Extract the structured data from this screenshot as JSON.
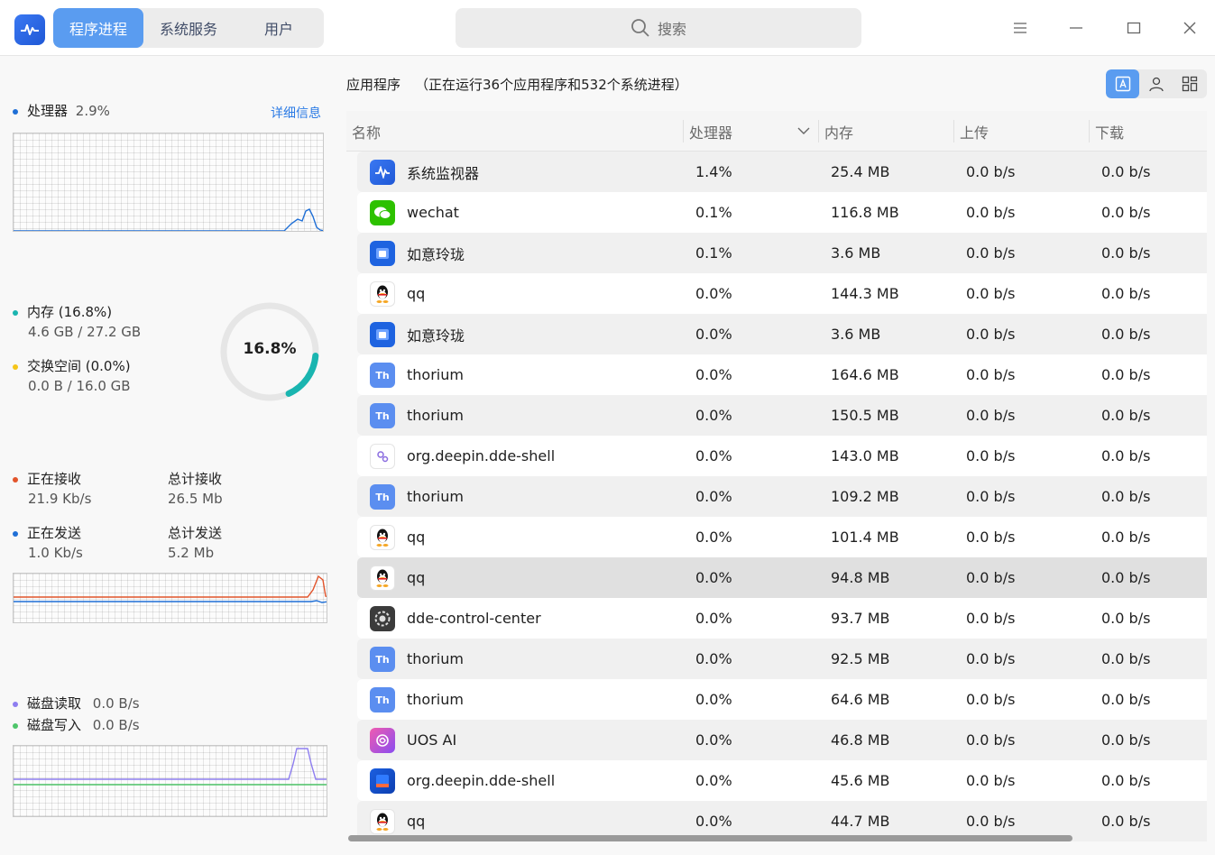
{
  "tabs": [
    "程序进程",
    "系统服务",
    "用户"
  ],
  "search": {
    "placeholder": "搜索"
  },
  "sidebar": {
    "cpu": {
      "label": "处理器",
      "value": "2.9%",
      "details_link": "详细信息",
      "color": "#1f6fd6"
    },
    "memory": {
      "label": "内存 (16.8%)",
      "detail": "4.6 GB / 27.2 GB",
      "percent_text": "16.8%",
      "percent": 16.8,
      "color": "#1ab5b0"
    },
    "swap": {
      "label": "交换空间 (0.0%)",
      "detail": "0.0 B / 16.0 GB",
      "color": "#f5c518"
    },
    "network": {
      "receiving_label": "正在接收",
      "receiving_value": "21.9 Kb/s",
      "total_received_label": "总计接收",
      "total_received_value": "26.5 Mb",
      "sending_label": "正在发送",
      "sending_value": "1.0 Kb/s",
      "total_sent_label": "总计发送",
      "total_sent_value": "5.2 Mb",
      "receive_color": "#e2542b",
      "send_color": "#1f6fd6"
    },
    "disk": {
      "read_label": "磁盘读取",
      "read_value": "0.0 B/s",
      "write_label": "磁盘写入",
      "write_value": "0.0 B/s",
      "read_color": "#8e7ef0",
      "write_color": "#4ec56a"
    }
  },
  "main": {
    "heading": "应用程序",
    "heading_note": "（正在运行36个应用程序和532个系统进程）",
    "columns": [
      "名称",
      "处理器",
      "内存",
      "上传",
      "下载"
    ],
    "rows": [
      {
        "icon": "system-monitor-icon",
        "name": "系统监视器",
        "cpu": "1.4%",
        "mem": "25.4 MB",
        "up": "0.0 b/s",
        "down": "0.0 b/s"
      },
      {
        "icon": "wechat-icon",
        "name": "wechat",
        "cpu": "0.1%",
        "mem": "116.8 MB",
        "up": "0.0 b/s",
        "down": "0.0 b/s"
      },
      {
        "icon": "ruyi-icon",
        "name": "如意玲珑",
        "cpu": "0.1%",
        "mem": "3.6 MB",
        "up": "0.0 b/s",
        "down": "0.0 b/s"
      },
      {
        "icon": "qq-icon",
        "name": "qq",
        "cpu": "0.0%",
        "mem": "144.3 MB",
        "up": "0.0 b/s",
        "down": "0.0 b/s"
      },
      {
        "icon": "ruyi-icon",
        "name": "如意玲珑",
        "cpu": "0.0%",
        "mem": "3.6 MB",
        "up": "0.0 b/s",
        "down": "0.0 b/s"
      },
      {
        "icon": "thorium-icon",
        "name": "thorium",
        "cpu": "0.0%",
        "mem": "164.6 MB",
        "up": "0.0 b/s",
        "down": "0.0 b/s"
      },
      {
        "icon": "thorium-icon",
        "name": "thorium",
        "cpu": "0.0%",
        "mem": "150.5 MB",
        "up": "0.0 b/s",
        "down": "0.0 b/s"
      },
      {
        "icon": "dde-shell-icon",
        "name": "org.deepin.dde-shell",
        "cpu": "0.0%",
        "mem": "143.0 MB",
        "up": "0.0 b/s",
        "down": "0.0 b/s"
      },
      {
        "icon": "thorium-icon",
        "name": "thorium",
        "cpu": "0.0%",
        "mem": "109.2 MB",
        "up": "0.0 b/s",
        "down": "0.0 b/s"
      },
      {
        "icon": "qq-icon",
        "name": "qq",
        "cpu": "0.0%",
        "mem": "101.4 MB",
        "up": "0.0 b/s",
        "down": "0.0 b/s"
      },
      {
        "icon": "qq-icon",
        "name": "qq",
        "cpu": "0.0%",
        "mem": "94.8 MB",
        "up": "0.0 b/s",
        "down": "0.0 b/s"
      },
      {
        "icon": "control-center-icon",
        "name": "dde-control-center",
        "cpu": "0.0%",
        "mem": "93.7 MB",
        "up": "0.0 b/s",
        "down": "0.0 b/s"
      },
      {
        "icon": "thorium-icon",
        "name": "thorium",
        "cpu": "0.0%",
        "mem": "92.5 MB",
        "up": "0.0 b/s",
        "down": "0.0 b/s"
      },
      {
        "icon": "thorium-icon",
        "name": "thorium",
        "cpu": "0.0%",
        "mem": "64.6 MB",
        "up": "0.0 b/s",
        "down": "0.0 b/s"
      },
      {
        "icon": "uos-ai-icon",
        "name": "UOS AI",
        "cpu": "0.0%",
        "mem": "46.8 MB",
        "up": "0.0 b/s",
        "down": "0.0 b/s"
      },
      {
        "icon": "dde-shell-launcher-icon",
        "name": "org.deepin.dde-shell",
        "cpu": "0.0%",
        "mem": "45.6 MB",
        "up": "0.0 b/s",
        "down": "0.0 b/s"
      },
      {
        "icon": "qq-icon",
        "name": "qq",
        "cpu": "0.0%",
        "mem": "44.7 MB",
        "up": "0.0 b/s",
        "down": "0.0 b/s"
      }
    ]
  },
  "colors": {
    "accent": "#5a9cf0",
    "link": "#2c7be5"
  }
}
